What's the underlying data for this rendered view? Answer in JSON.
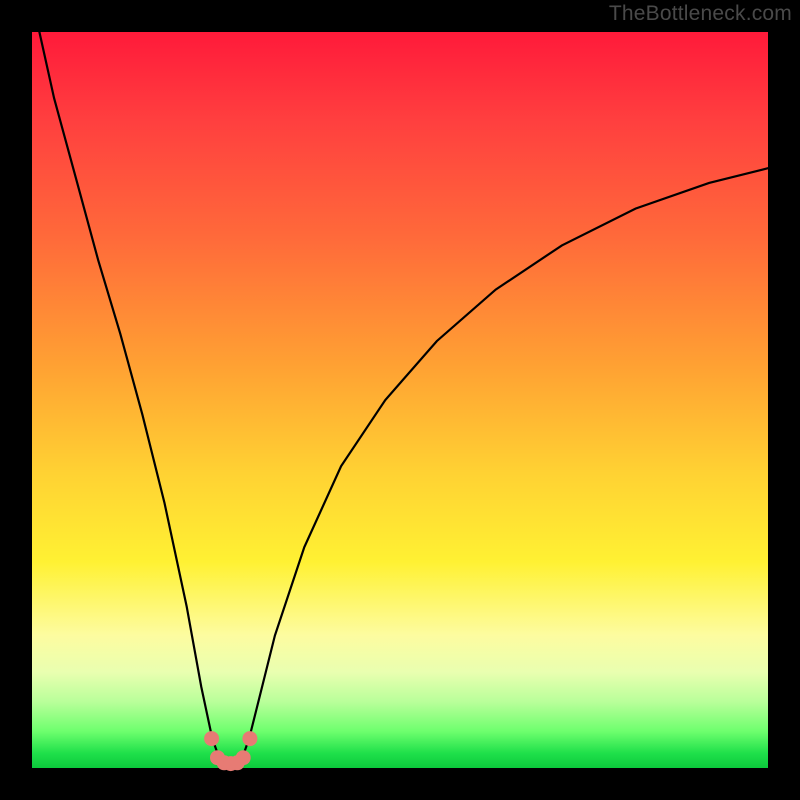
{
  "watermark": "TheBottleneck.com",
  "chart_data": {
    "type": "line",
    "title": "",
    "xlabel": "",
    "ylabel": "",
    "xlim": [
      0,
      100
    ],
    "ylim": [
      0,
      100
    ],
    "series": [
      {
        "name": "bottleneck-curve",
        "x": [
          1,
          3,
          6,
          9,
          12,
          15,
          18,
          21,
          23,
          24.5,
          25.5,
          26.5,
          27.5,
          28.5,
          29.5,
          31,
          33,
          37,
          42,
          48,
          55,
          63,
          72,
          82,
          92,
          100
        ],
        "y": [
          100,
          91,
          80,
          69,
          59,
          48,
          36,
          22,
          11,
          4,
          1.2,
          0.6,
          0.6,
          1.2,
          4,
          10,
          18,
          30,
          41,
          50,
          58,
          65,
          71,
          76,
          79.5,
          81.5
        ]
      }
    ],
    "markers": {
      "name": "min-region-dots",
      "x": [
        24.4,
        25.2,
        26.1,
        27.0,
        27.9,
        28.7,
        29.6
      ],
      "y": [
        4.0,
        1.4,
        0.7,
        0.6,
        0.7,
        1.4,
        4.0
      ]
    },
    "gradient_stops": [
      {
        "pos": 0.0,
        "color": "#ff1a3a"
      },
      {
        "pos": 0.12,
        "color": "#ff3f3f"
      },
      {
        "pos": 0.28,
        "color": "#ff6a3a"
      },
      {
        "pos": 0.45,
        "color": "#ffa033"
      },
      {
        "pos": 0.6,
        "color": "#ffd233"
      },
      {
        "pos": 0.72,
        "color": "#fff133"
      },
      {
        "pos": 0.82,
        "color": "#fdfca0"
      },
      {
        "pos": 0.87,
        "color": "#e9ffb0"
      },
      {
        "pos": 0.91,
        "color": "#b9ff9a"
      },
      {
        "pos": 0.95,
        "color": "#6eff6e"
      },
      {
        "pos": 0.98,
        "color": "#1fe04a"
      },
      {
        "pos": 1.0,
        "color": "#0cc93c"
      }
    ]
  }
}
